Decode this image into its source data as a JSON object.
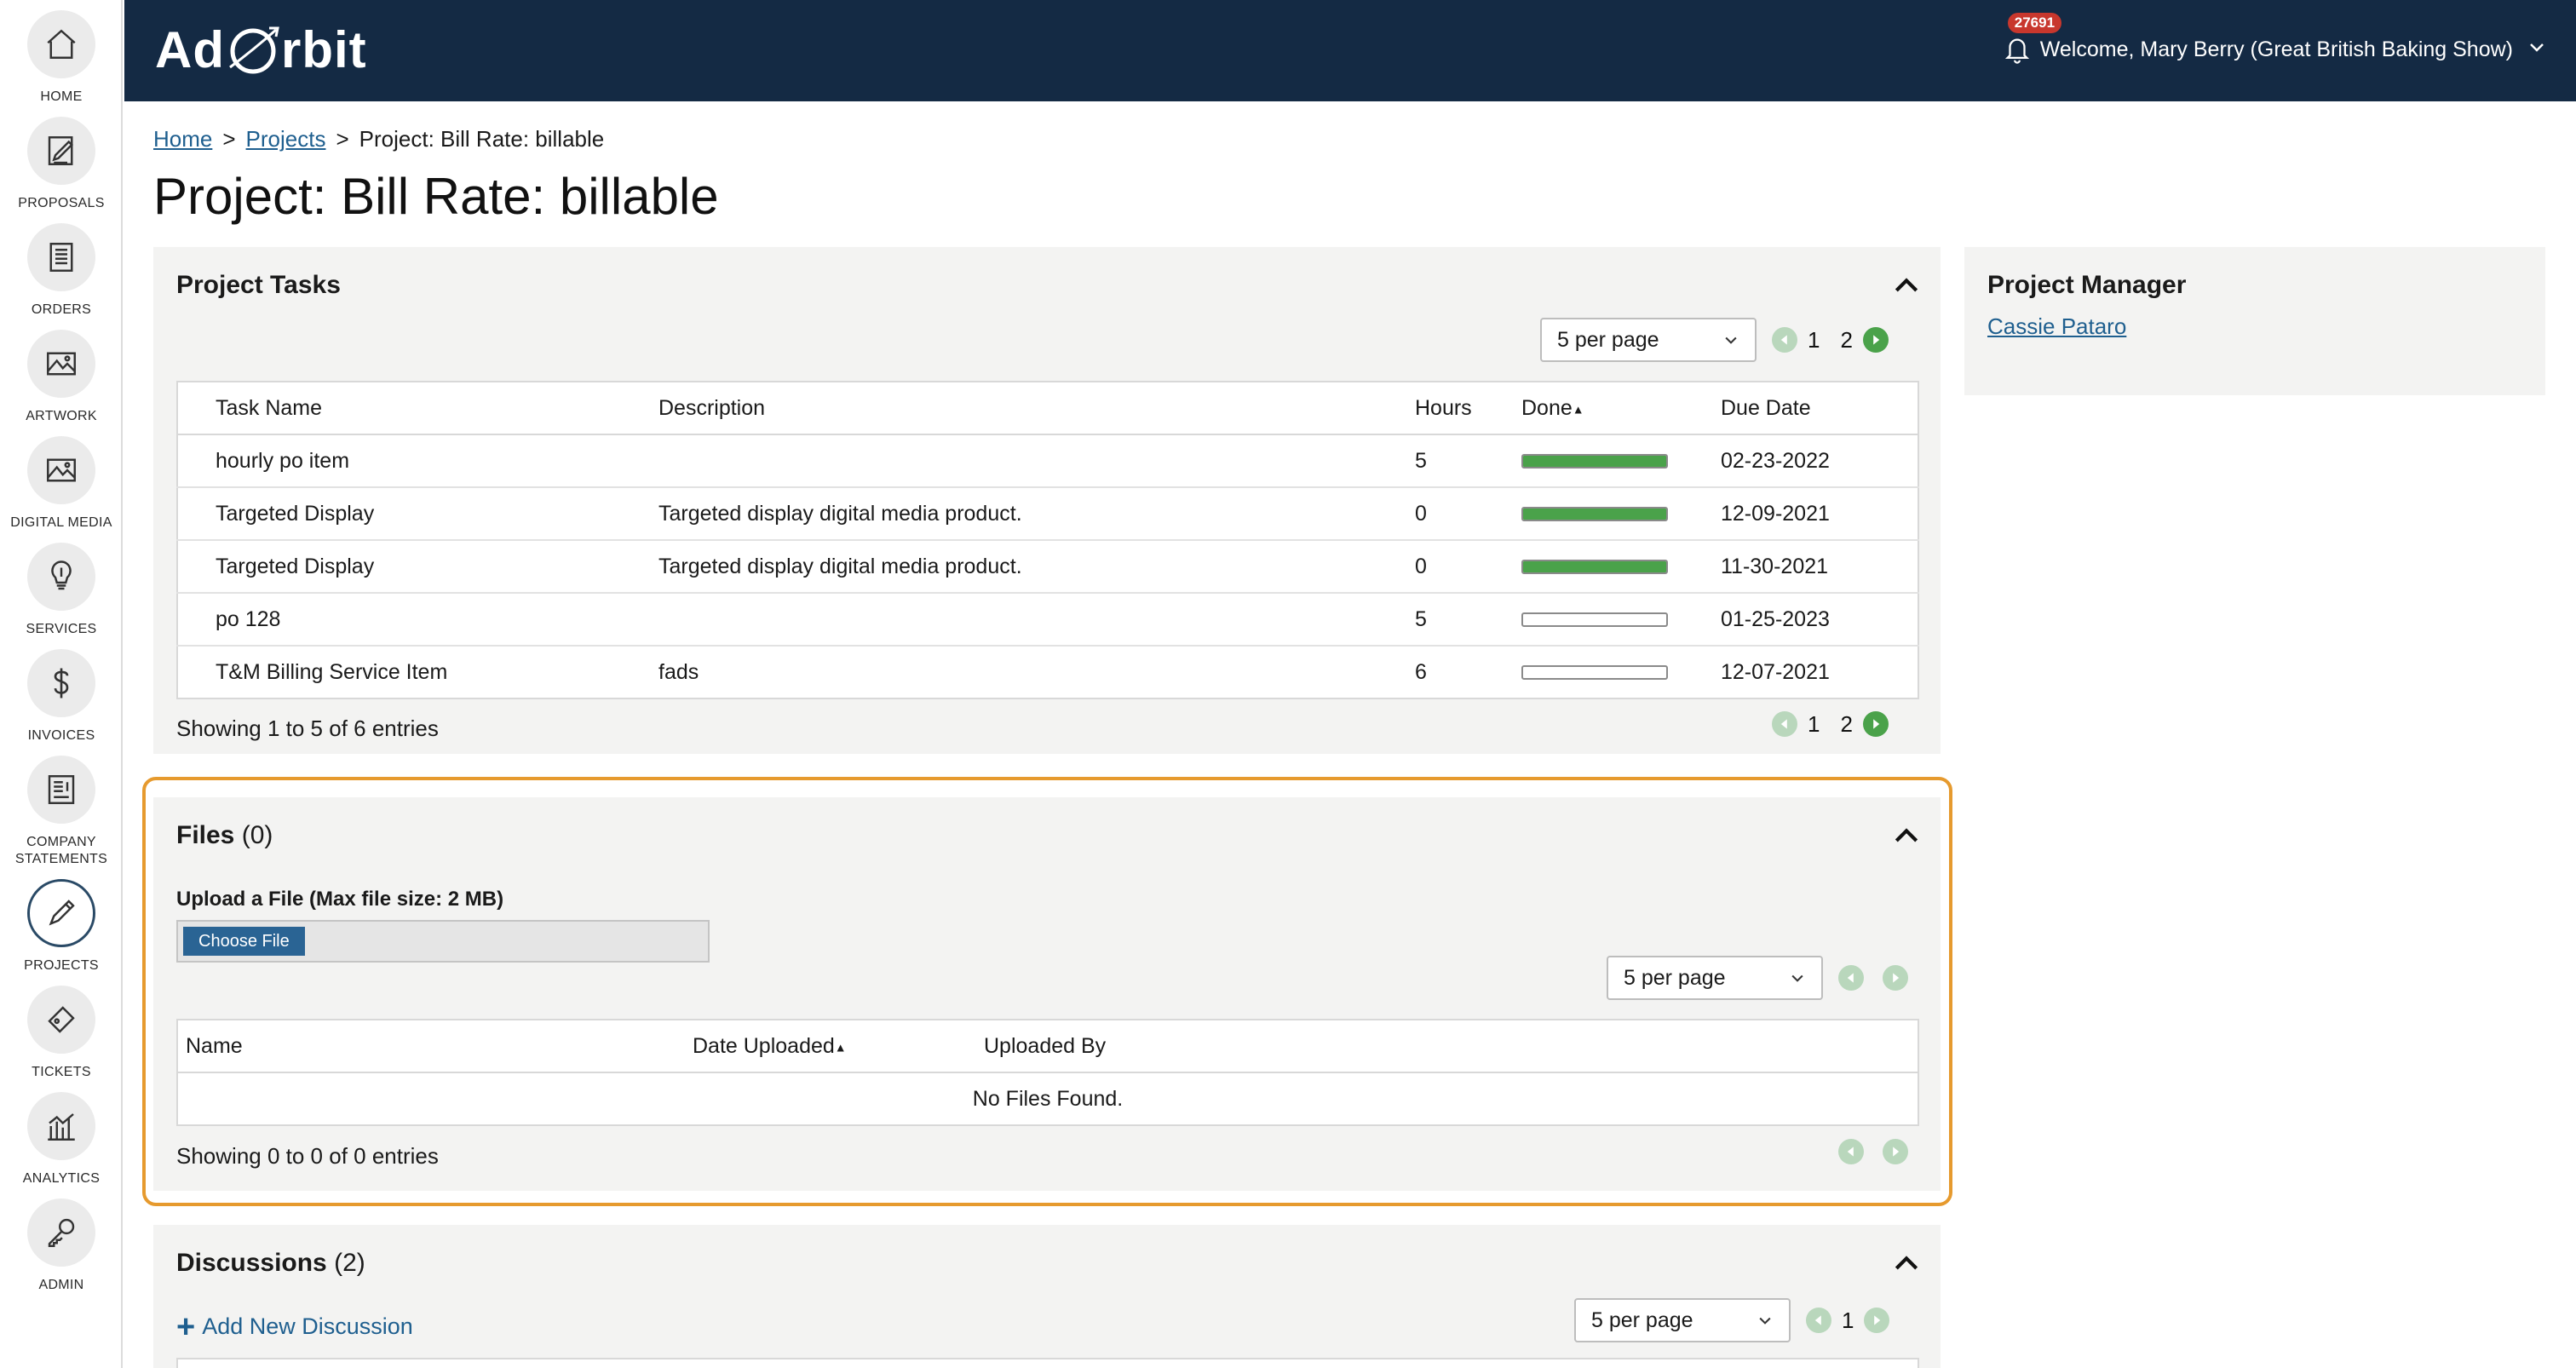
{
  "sidebar": {
    "items": [
      {
        "label": "HOME",
        "icon": "home-icon"
      },
      {
        "label": "PROPOSALS",
        "icon": "proposal-icon"
      },
      {
        "label": "ORDERS",
        "icon": "orders-icon"
      },
      {
        "label": "ARTWORK",
        "icon": "image-icon"
      },
      {
        "label": "DIGITAL MEDIA",
        "icon": "image-icon"
      },
      {
        "label": "SERVICES",
        "icon": "lightbulb-icon"
      },
      {
        "label": "INVOICES",
        "icon": "dollar-icon"
      },
      {
        "label": "COMPANY STATEMENTS",
        "icon": "statement-icon"
      },
      {
        "label": "PROJECTS",
        "icon": "pencil-icon"
      },
      {
        "label": "TICKETS",
        "icon": "ticket-icon"
      },
      {
        "label": "ANALYTICS",
        "icon": "chart-icon"
      },
      {
        "label": "ADMIN",
        "icon": "key-icon"
      }
    ],
    "active": "PROJECTS"
  },
  "header": {
    "logo_left": "Ad",
    "logo_right": "rbit",
    "notification_count": "27691",
    "welcome": "Welcome, Mary Berry (Great British Baking Show)",
    "colors": {
      "bar": "#142a44",
      "badge": "#c8372d"
    }
  },
  "breadcrumb": {
    "home": "Home",
    "projects": "Projects",
    "separator": ">",
    "current": "Project: Bill Rate: billable"
  },
  "page_title": "Project: Bill Rate: billable",
  "tasks": {
    "title": "Project Tasks",
    "per_page": "5 per page",
    "pages": [
      "1",
      "2"
    ],
    "columns": {
      "name": "Task Name",
      "description": "Description",
      "hours": "Hours",
      "done": "Done",
      "due": "Due Date"
    },
    "rows": [
      {
        "name": "hourly po item",
        "description": "",
        "hours": "5",
        "done": 1.0,
        "due": "02-23-2022"
      },
      {
        "name": "Targeted Display",
        "description": "Targeted display digital media product.",
        "hours": "0",
        "done": 1.0,
        "due": "12-09-2021"
      },
      {
        "name": "Targeted Display",
        "description": "Targeted display digital media product.",
        "hours": "0",
        "done": 1.0,
        "due": "11-30-2021"
      },
      {
        "name": "po 128",
        "description": "",
        "hours": "5",
        "done": 0.0,
        "due": "01-25-2023"
      },
      {
        "name": "T&M Billing Service Item",
        "description": "fads",
        "hours": "6",
        "done": 0.0,
        "due": "12-07-2021"
      }
    ],
    "showing": "Showing 1 to 5 of 6 entries",
    "colors": {
      "progress": "#4aa24a"
    }
  },
  "files": {
    "title": "Files",
    "count": "(0)",
    "upload_label": "Upload a File (Max file size: 2 MB)",
    "choose_label": "Choose File",
    "per_page": "5 per page",
    "columns": {
      "name": "Name",
      "date": "Date Uploaded",
      "by": "Uploaded By"
    },
    "empty": "No Files Found.",
    "showing": "Showing 0 to 0 of 0 entries"
  },
  "discussions": {
    "title": "Discussions",
    "count": "(2)",
    "add_label": "Add New Discussion",
    "per_page": "5 per page",
    "page": "1"
  },
  "manager": {
    "title": "Project Manager",
    "name": "Cassie Pataro"
  }
}
